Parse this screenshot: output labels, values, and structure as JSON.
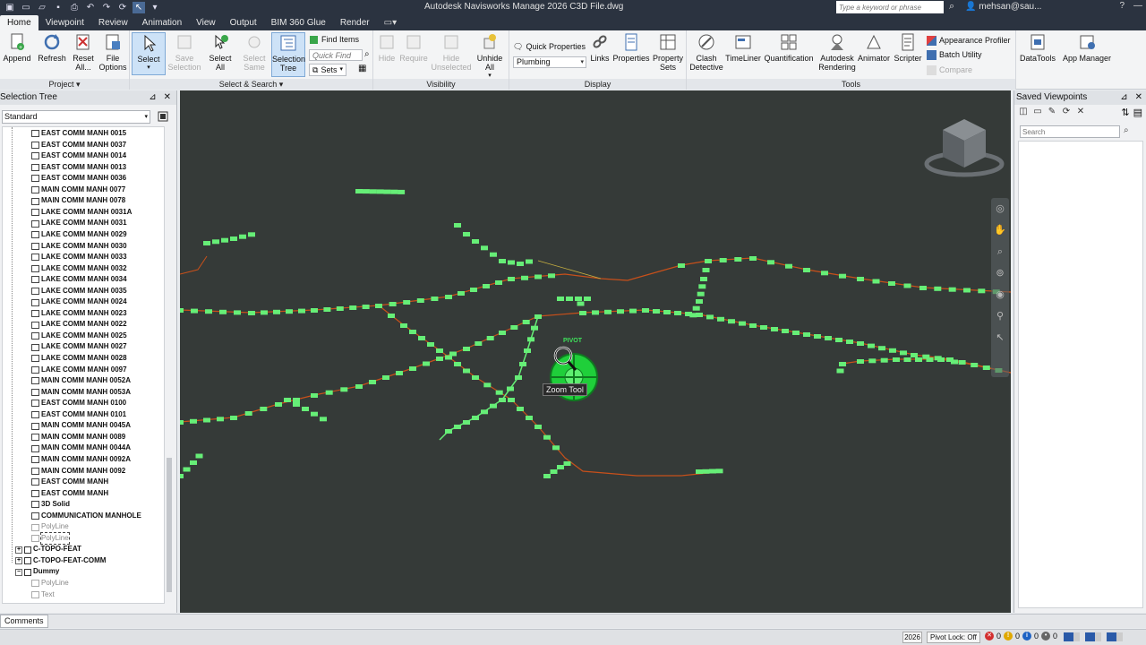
{
  "titlebar": {
    "title": "Autodesk Navisworks Manage 2026    C3D File.dwg",
    "search_placeholder": "Type a keyword or phrase",
    "user": "mehsan@sau..."
  },
  "menu_tabs": [
    {
      "label": "Home",
      "active": true
    },
    {
      "label": "Viewpoint"
    },
    {
      "label": "Review"
    },
    {
      "label": "Animation"
    },
    {
      "label": "View"
    },
    {
      "label": "Output"
    },
    {
      "label": "BIM 360 Glue"
    },
    {
      "label": "Render"
    }
  ],
  "ribbon": {
    "project": {
      "label": "Project",
      "append": "Append",
      "refresh": "Refresh",
      "reset_all": "Reset All...",
      "file_options": "File Options"
    },
    "select_search": {
      "label": "Select & Search",
      "select": "Select",
      "save_selection": "Save Selection",
      "select_all": "Select All",
      "select_same": "Select Same",
      "selection_tree": "Selection Tree",
      "find_items": "Find Items",
      "quick_find_placeholder": "Quick Find",
      "sets": "Sets"
    },
    "visibility": {
      "label": "Visibility",
      "hide": "Hide",
      "require": "Require",
      "hide_unselected": "Hide Unselected",
      "unhide_all": "Unhide All"
    },
    "display": {
      "label": "Display",
      "quick_properties": "Quick Properties",
      "combo_value": "Plumbing",
      "links": "Links",
      "properties": "Properties",
      "property_sets": "Property Sets"
    },
    "tools": {
      "label": "Tools",
      "clash_detective": "Clash Detective",
      "timeliner": "TimeLiner",
      "quantification": "Quantification",
      "autodesk_rendering": "Autodesk Rendering",
      "animator": "Animator",
      "scripter": "Scripter",
      "appearance_profiler": "Appearance Profiler",
      "batch_utility": "Batch Utility",
      "compare": "Compare"
    },
    "datatools": "DataTools",
    "app_manager": "App Manager"
  },
  "selection_tree": {
    "title": "Selection Tree",
    "mode": "Standard",
    "items": [
      {
        "label": "EAST COMM MANH 0015",
        "type": "item"
      },
      {
        "label": "EAST COMM MANH 0037",
        "type": "item"
      },
      {
        "label": "EAST COMM MANH 0014",
        "type": "item"
      },
      {
        "label": "EAST COMM MANH 0013",
        "type": "item"
      },
      {
        "label": "EAST COMM MANH 0036",
        "type": "item"
      },
      {
        "label": "MAIN COMM MANH 0077",
        "type": "item"
      },
      {
        "label": "MAIN COMM MANH 0078",
        "type": "item"
      },
      {
        "label": "LAKE COMM MANH 0031A",
        "type": "item"
      },
      {
        "label": "LAKE COMM MANH 0031",
        "type": "item"
      },
      {
        "label": "LAKE COMM MANH 0029",
        "type": "item"
      },
      {
        "label": "LAKE COMM MANH 0030",
        "type": "item"
      },
      {
        "label": "LAKE COMM MANH 0033",
        "type": "item"
      },
      {
        "label": "LAKE COMM MANH 0032",
        "type": "item"
      },
      {
        "label": "LAKE COMM MANH 0034",
        "type": "item"
      },
      {
        "label": "LAKE COMM MANH 0035",
        "type": "item"
      },
      {
        "label": "LAKE COMM MANH 0024",
        "type": "item"
      },
      {
        "label": "LAKE COMM MANH 0023",
        "type": "item"
      },
      {
        "label": "LAKE COMM MANH 0022",
        "type": "item"
      },
      {
        "label": "LAKE COMM MANH 0025",
        "type": "item"
      },
      {
        "label": "LAKE COMM MANH 0027",
        "type": "item"
      },
      {
        "label": "LAKE COMM MANH 0028",
        "type": "item"
      },
      {
        "label": "LAKE COMM MANH 0097",
        "type": "item"
      },
      {
        "label": "MAIN COMM MANH 0052A",
        "type": "item"
      },
      {
        "label": "MAIN COMM MANH 0053A",
        "type": "item"
      },
      {
        "label": "EAST COMM MANH 0100",
        "type": "item"
      },
      {
        "label": "EAST COMM MANH 0101",
        "type": "item"
      },
      {
        "label": "MAIN COMM MANH 0045A",
        "type": "item"
      },
      {
        "label": "MAIN COMM MANH 0089",
        "type": "item"
      },
      {
        "label": "MAIN COMM MANH 0044A",
        "type": "item"
      },
      {
        "label": "MAIN COMM MANH 0092A",
        "type": "item"
      },
      {
        "label": "MAIN COMM MANH 0092",
        "type": "item"
      },
      {
        "label": "EAST COMM MANH",
        "type": "item"
      },
      {
        "label": "EAST COMM MANH",
        "type": "item"
      },
      {
        "label": "3D Solid",
        "type": "item"
      },
      {
        "label": "COMMUNICATION MANHOLE",
        "type": "item"
      },
      {
        "label": "PolyLine",
        "type": "dim"
      },
      {
        "label": "PolyLine",
        "type": "dim-focus"
      },
      {
        "label": "C-TOPO-FEAT",
        "type": "layer"
      },
      {
        "label": "C-TOPO-FEAT-COMM",
        "type": "layer"
      },
      {
        "label": "Dummy",
        "type": "layer-open"
      },
      {
        "label": "PolyLine",
        "type": "dim"
      },
      {
        "label": "Text",
        "type": "dim"
      }
    ]
  },
  "viewport": {
    "pivot_label": "PIVOT",
    "tooltip": "Zoom Tool"
  },
  "saved_viewpoints": {
    "title": "Saved Viewpoints",
    "search_placeholder": "Search"
  },
  "bottom_tabs": [
    {
      "label": "Comments"
    }
  ],
  "status": {
    "page": "2026",
    "pivot_lock": "Pivot Lock: Off",
    "errors": "0",
    "warnings": "0",
    "info": "0",
    "messages": "0"
  },
  "colors": {
    "title_bg": "#2b3340",
    "viewport_bg": "#353a38",
    "node_green": "#66ee77",
    "pipe_orange": "#c8501a",
    "pivot_green": "#1fcf3a"
  }
}
